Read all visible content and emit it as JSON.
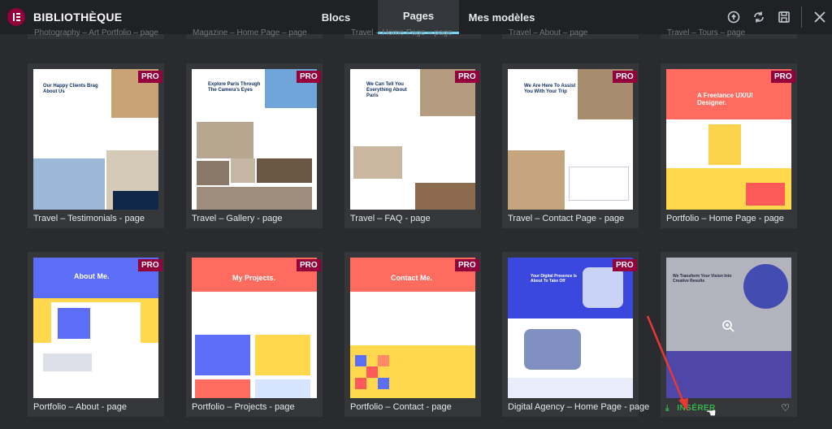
{
  "header": {
    "title": "BIBLIOTHÈQUE",
    "tabs": [
      "Blocs",
      "Pages",
      "Mes modèles"
    ],
    "active_tab": "Pages",
    "action_icons": [
      "info-icon",
      "sync-icon",
      "save-icon",
      "close-icon"
    ]
  },
  "previous_row_labels": [
    "Photography – Art Portfolio – page",
    "Magazine – Home Page – page",
    "Travel – Home Page – page",
    "Travel – About – page",
    "Travel – Tours – page"
  ],
  "pro_badge": "PRO",
  "templates_row1": [
    {
      "title": "Travel – Testimonials - page",
      "heading": "Our Happy Clients Brag About Us"
    },
    {
      "title": "Travel – Gallery - page",
      "heading": "Explore Paris Through The Camera's Eyes"
    },
    {
      "title": "Travel – FAQ - page",
      "heading": "We Can Tell You Everything About Paris"
    },
    {
      "title": "Travel – Contact Page - page",
      "heading": "We Are Here To Assist You With Your Trip"
    },
    {
      "title": "Portfolio – Home Page - page",
      "heading": "A Freelance UX/UI Designer."
    }
  ],
  "templates_row2": [
    {
      "title": "Portfolio – About - page",
      "heading": "About Me."
    },
    {
      "title": "Portfolio – Projects - page",
      "heading": "My Projects."
    },
    {
      "title": "Portfolio – Contact - page",
      "heading": "Contact Me."
    },
    {
      "title": "Digital Agency – Home Page - page",
      "heading": "Your Digital Presence Is About To Take Off"
    },
    {
      "title": "",
      "heading": "We Transform Your Vision Into Creative Results",
      "insert_label": "INSÉRER"
    }
  ],
  "colors": {
    "accent": "#71d7f7",
    "pro": "#93003c",
    "insert": "#39b54a",
    "arrow": "#e53935"
  }
}
